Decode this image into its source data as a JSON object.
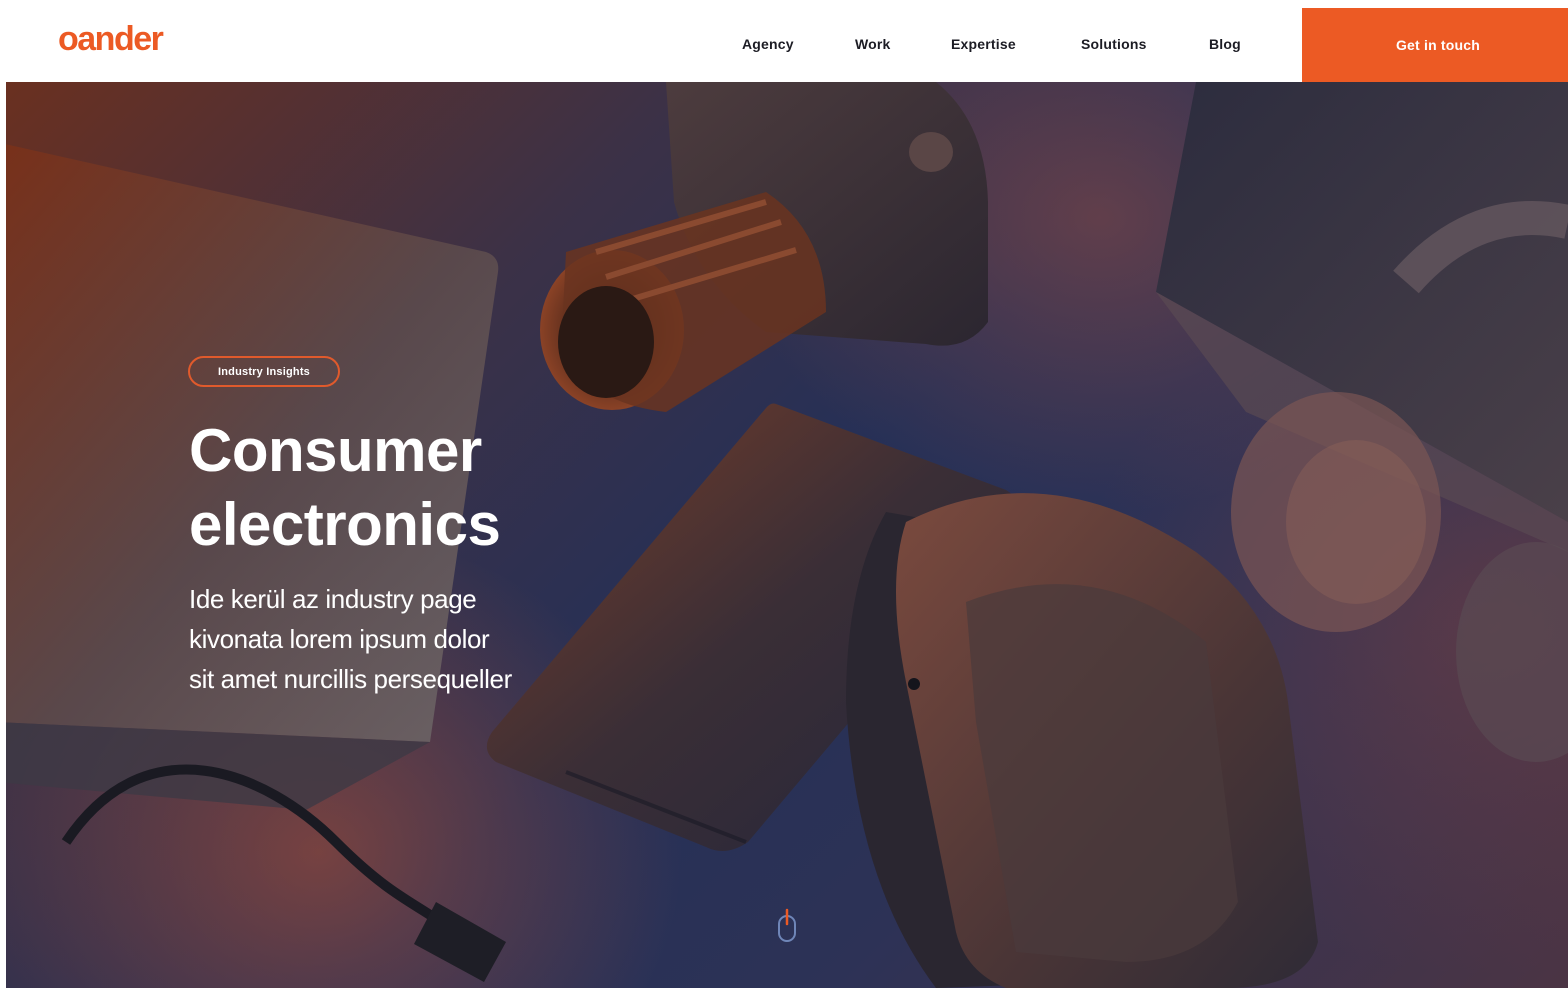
{
  "brand": {
    "logo_text": "oander",
    "accent_color": "#ec5a24"
  },
  "nav": {
    "items": [
      {
        "label": "Agency"
      },
      {
        "label": "Work"
      },
      {
        "label": "Expertise"
      },
      {
        "label": "Solutions"
      },
      {
        "label": "Blog"
      }
    ],
    "cta_label": "Get in touch"
  },
  "hero": {
    "tag_label": "Industry Insights",
    "title_line1": "Consumer",
    "title_line2": "electronics",
    "lead_line1": "Ide kerül az industry page",
    "lead_line2": "kivonata lorem ipsum dolor",
    "lead_line3": "sit amet nurcillis persequeller",
    "scroll_icon": "mouse-scroll-icon"
  }
}
